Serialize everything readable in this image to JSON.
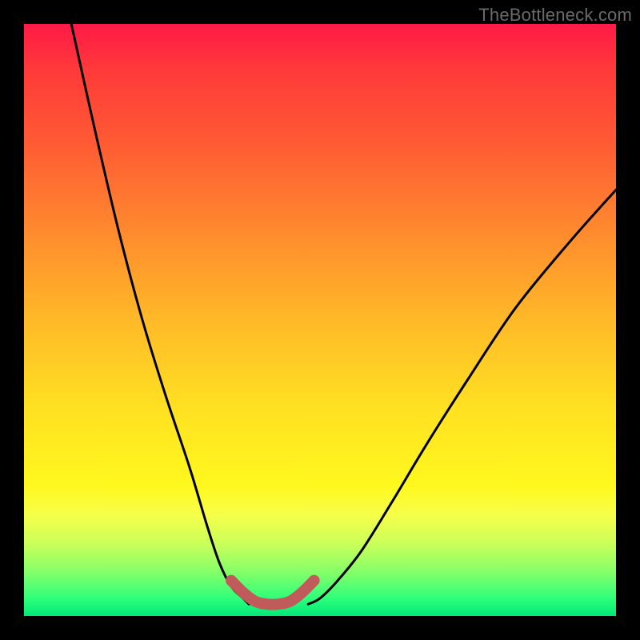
{
  "watermark": {
    "text": "TheBottleneck.com"
  },
  "chart_data": {
    "type": "line",
    "title": "",
    "xlabel": "",
    "ylabel": "",
    "xlim": [
      0,
      100
    ],
    "ylim": [
      0,
      100
    ],
    "grid": false,
    "legend": false,
    "series": [
      {
        "name": "left-curve",
        "x": [
          8,
          12,
          16,
          20,
          24,
          28,
          31,
          33,
          35,
          37,
          38
        ],
        "values": [
          100,
          82,
          65,
          50,
          37,
          25,
          15,
          9,
          5,
          3,
          2
        ]
      },
      {
        "name": "right-curve",
        "x": [
          48,
          50,
          53,
          57,
          62,
          68,
          75,
          83,
          92,
          100
        ],
        "values": [
          2,
          3,
          6,
          11,
          19,
          29,
          40,
          52,
          63,
          72
        ]
      },
      {
        "name": "valley-highlight",
        "x": [
          35,
          37,
          39,
          41,
          43,
          45,
          47,
          49
        ],
        "values": [
          6,
          4,
          2.5,
          2,
          2,
          2.5,
          4,
          6
        ]
      }
    ],
    "colors": {
      "curve": "#000000",
      "highlight": "#c15b5b"
    }
  }
}
